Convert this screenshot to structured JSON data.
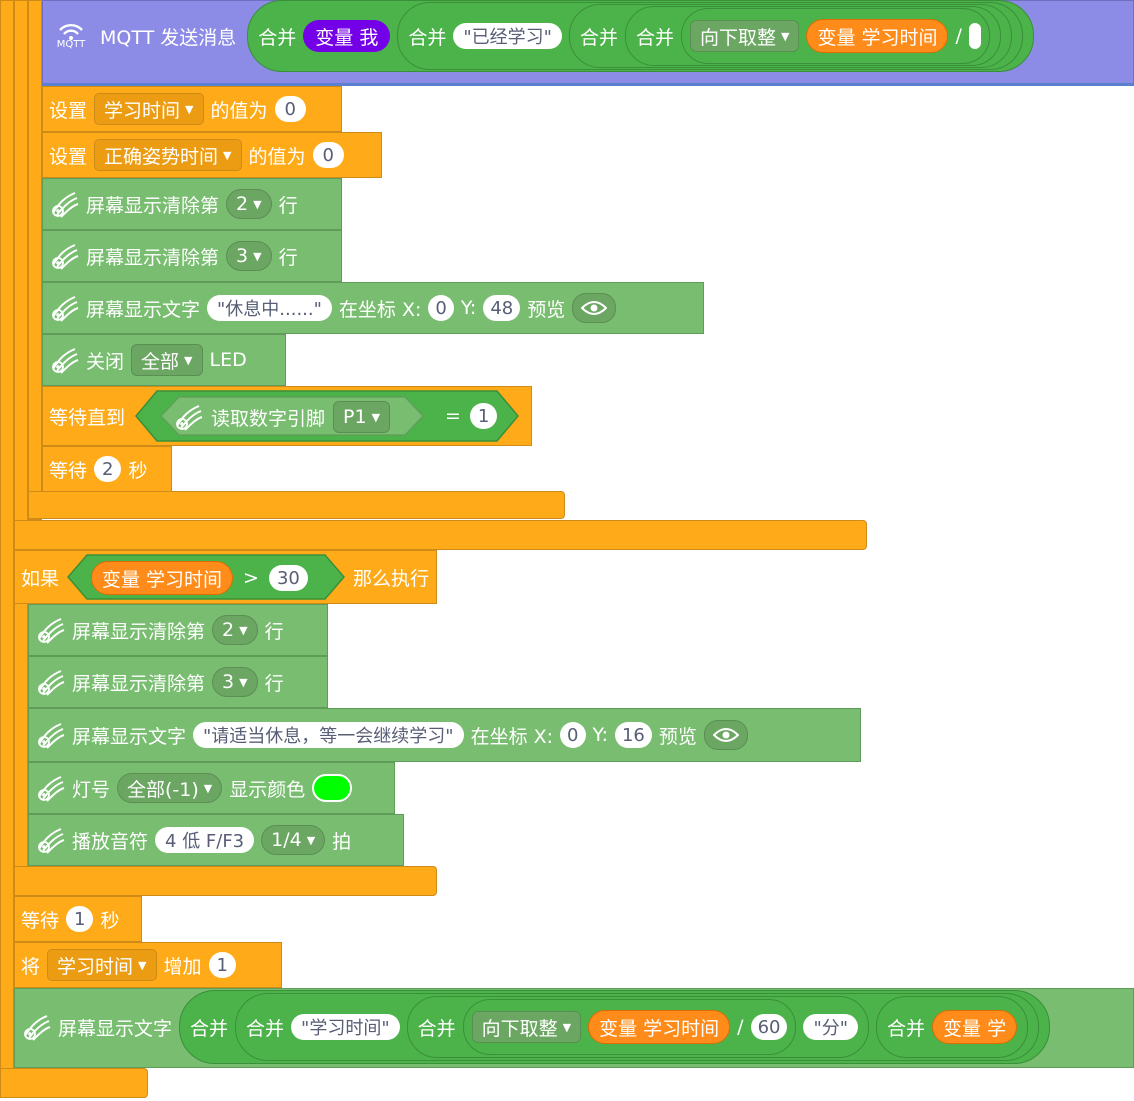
{
  "mqtt": {
    "label": "MQTT 发送消息",
    "icon_text": "MQTT",
    "join1": "合并",
    "var_me": "变量 我",
    "join2": "合并",
    "str_learned": "\"已经学习\"",
    "join3": "合并",
    "join4": "合并",
    "floor": "向下取整",
    "var_study": "变量 学习时间",
    "div": "/"
  },
  "set1": {
    "set": "设置",
    "var": "学习时间",
    "value_of": "的值为",
    "val": "0"
  },
  "set2": {
    "set": "设置",
    "var": "正确姿势时间",
    "value_of": "的值为",
    "val": "0"
  },
  "clear2": {
    "label": "屏幕显示清除第",
    "line": "2",
    "row": "行"
  },
  "clear3": {
    "label": "屏幕显示清除第",
    "line": "3",
    "row": "行"
  },
  "show_rest": {
    "label": "屏幕显示文字",
    "text": "\"休息中......\"",
    "at": "在坐标 X:",
    "x": "0",
    "y_label": "Y:",
    "y": "48",
    "preview": "预览"
  },
  "led_off": {
    "label": "关闭",
    "target": "全部",
    "led": "LED"
  },
  "wait_until": {
    "label": "等待直到",
    "read": "读取数字引脚",
    "pin": "P1",
    "eq": "=",
    "val": "1"
  },
  "wait2": {
    "label": "等待",
    "val": "2",
    "unit": "秒"
  },
  "if_block": {
    "if": "如果",
    "var": "变量 学习时间",
    "op": ">",
    "val": "30",
    "then": "那么执行"
  },
  "clear2b": {
    "label": "屏幕显示清除第",
    "line": "2",
    "row": "行"
  },
  "clear3b": {
    "label": "屏幕显示清除第",
    "line": "3",
    "row": "行"
  },
  "show_msg": {
    "label": "屏幕显示文字",
    "text": "\"请适当休息，等一会继续学习\"",
    "at": "在坐标 X:",
    "x": "0",
    "y_label": "Y:",
    "y": "16",
    "preview": "预览"
  },
  "lamp": {
    "label": "灯号",
    "target": "全部(-1)",
    "color_label": "显示颜色",
    "color": "#00ff00"
  },
  "note": {
    "label": "播放音符",
    "note": "4 低 F/F3",
    "beat": "1/4",
    "unit": "拍"
  },
  "wait1": {
    "label": "等待",
    "val": "1",
    "unit": "秒"
  },
  "inc": {
    "label": "将",
    "var": "学习时间",
    "add": "增加",
    "val": "1"
  },
  "show_bottom": {
    "label": "屏幕显示文字",
    "join1": "合并",
    "join2": "合并",
    "str_time": "\"学习时间\"",
    "join3": "合并",
    "floor": "向下取整",
    "var_study": "变量 学习时间",
    "div": "/",
    "den": "60",
    "str_min": "\"分\"",
    "join4": "合并",
    "var_study_cut": "变量 学"
  }
}
